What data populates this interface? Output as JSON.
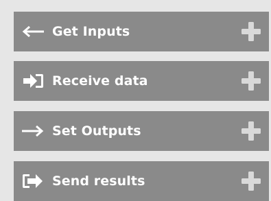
{
  "panels": [
    {
      "label": "Get Inputs",
      "icon": "arrow-left-icon",
      "expand_icon": "plus-icon"
    },
    {
      "label": "Receive data",
      "icon": "sign-in-icon",
      "expand_icon": "plus-icon"
    },
    {
      "label": "Set Outputs",
      "icon": "arrow-right-icon",
      "expand_icon": "plus-icon"
    },
    {
      "label": "Send results",
      "icon": "sign-out-icon",
      "expand_icon": "plus-icon"
    }
  ],
  "colors": {
    "background": "#e6e6e6",
    "panel": "#8a8a8a",
    "text": "#ffffff",
    "plus": "#d9d9d9"
  }
}
